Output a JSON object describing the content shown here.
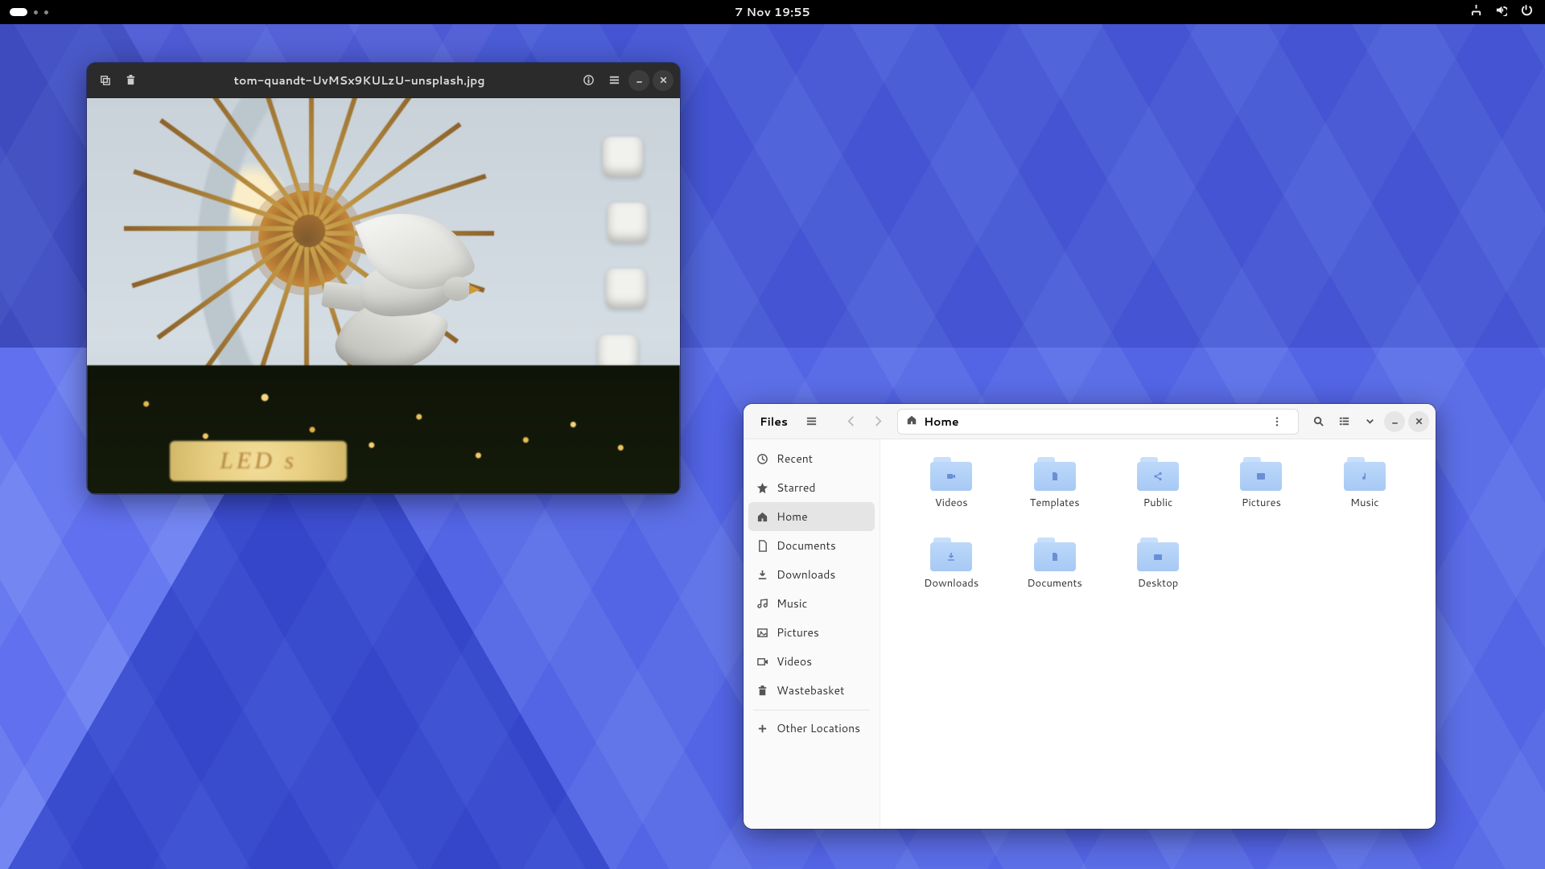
{
  "topbar": {
    "datetime": "7 Nov  19:55"
  },
  "imageViewer": {
    "title": "tom-quandt-UvMSx9KULzU-unsplash.jpg",
    "signText": "LED s"
  },
  "files": {
    "title": "Files",
    "path": "Home",
    "sidebar": [
      {
        "id": "recent",
        "label": "Recent"
      },
      {
        "id": "starred",
        "label": "Starred"
      },
      {
        "id": "home",
        "label": "Home",
        "active": true
      },
      {
        "id": "documents",
        "label": "Documents"
      },
      {
        "id": "downloads",
        "label": "Downloads"
      },
      {
        "id": "music",
        "label": "Music"
      },
      {
        "id": "pictures",
        "label": "Pictures"
      },
      {
        "id": "videos",
        "label": "Videos"
      },
      {
        "id": "trash",
        "label": "Wastebasket"
      }
    ],
    "otherLocations": "Other Locations",
    "folders": [
      {
        "id": "videos",
        "label": "Videos",
        "glyph": "video"
      },
      {
        "id": "templates",
        "label": "Templates",
        "glyph": "file"
      },
      {
        "id": "public",
        "label": "Public",
        "glyph": "share"
      },
      {
        "id": "pictures",
        "label": "Pictures",
        "glyph": "image"
      },
      {
        "id": "music",
        "label": "Music",
        "glyph": "music"
      },
      {
        "id": "downloads",
        "label": "Downloads",
        "glyph": "download"
      },
      {
        "id": "documents",
        "label": "Documents",
        "glyph": "file"
      },
      {
        "id": "desktop",
        "label": "Desktop",
        "glyph": "folder"
      }
    ]
  }
}
